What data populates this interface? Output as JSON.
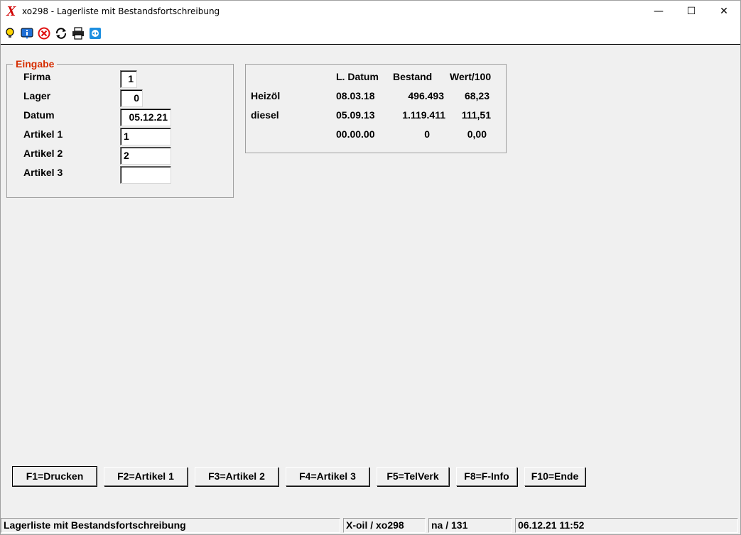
{
  "window": {
    "title": "xo298 - Lagerliste mit Bestandsfortschreibung",
    "minimize": "—",
    "maximize": "☐",
    "close": "✕"
  },
  "toolbar": {
    "icons": [
      "lightbulb-icon",
      "info-icon",
      "cancel-icon",
      "refresh-icon",
      "printer-icon",
      "teamviewer-icon"
    ]
  },
  "input_group": {
    "legend": "Eingabe",
    "fields": [
      {
        "label": "Firma",
        "value": "1"
      },
      {
        "label": "Lager",
        "value": "0"
      },
      {
        "label": "Datum",
        "value": "05.12.21"
      },
      {
        "label": "Artikel 1",
        "value": "1"
      },
      {
        "label": "Artikel 2",
        "value": "2"
      },
      {
        "label": "Artikel 3",
        "value": ""
      }
    ]
  },
  "stock_table": {
    "headers": [
      "L. Datum",
      "Bestand",
      "Wert/100"
    ],
    "rows": [
      {
        "name": "Heizöl",
        "date": "08.03.18",
        "stock": "496.493",
        "value": "68,23"
      },
      {
        "name": "diesel",
        "date": "05.09.13",
        "stock": "1.119.411",
        "value": "111,51"
      },
      {
        "name": "",
        "date": "00.00.00",
        "stock": "0",
        "value": "0,00"
      }
    ]
  },
  "buttons": [
    "F1=Drucken",
    "F2=Artikel 1",
    "F3=Artikel 2",
    "F4=Artikel 3",
    "F5=TelVerk",
    "F8=F-Info",
    "F10=Ende"
  ],
  "statusbar": {
    "description": "Lagerliste mit Bestandsfortschreibung",
    "program": "X-oil / xo298",
    "user": "na / 131",
    "datetime": "06.12.21 11:52"
  },
  "colors": {
    "accent": "#d62d00",
    "background": "#f0f0f0"
  }
}
